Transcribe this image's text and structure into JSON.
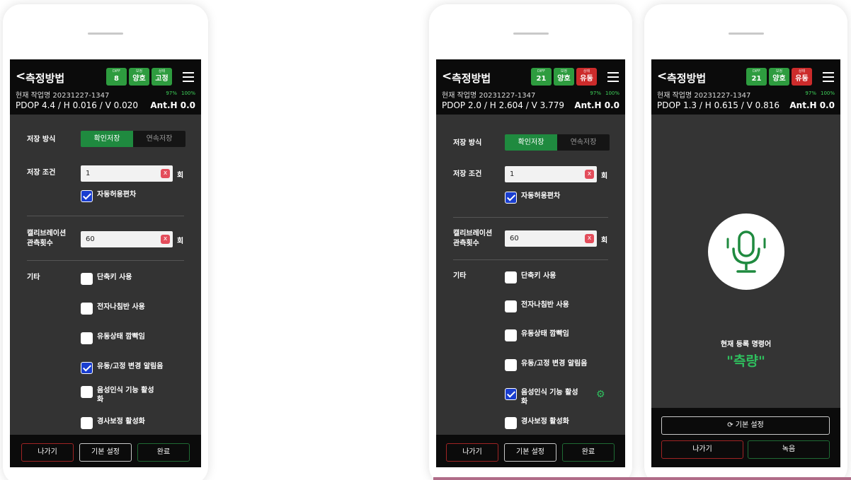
{
  "header": {
    "back_icon": "<",
    "title": "측정방법",
    "job_label": "현재 작업명 20231227-1347",
    "battery": "97%",
    "storage": "100%",
    "ant_h": "Ant.H 0.0"
  },
  "phone1": {
    "badges": [
      {
        "label": "DIFF",
        "value": "8",
        "color": "#2e9c3f"
      },
      {
        "label": "보정",
        "value": "양호",
        "color": "#2e9c3f"
      },
      {
        "label": "상태",
        "value": "고정",
        "color": "#2e9c3f"
      }
    ],
    "dop": "PDOP 4.4 / H 0.016 / V 0.020"
  },
  "phone2": {
    "badges": [
      {
        "label": "DIFF",
        "value": "21",
        "color": "#2e9c3f"
      },
      {
        "label": "보정",
        "value": "양호",
        "color": "#2e9c3f"
      },
      {
        "label": "상태",
        "value": "유동",
        "color": "#cc2b2b"
      }
    ],
    "dop": "PDOP 2.0 / H 2.604 / V 3.779"
  },
  "phone3": {
    "badges": [
      {
        "label": "DIFF",
        "value": "21",
        "color": "#2e9c3f"
      },
      {
        "label": "보정",
        "value": "양호",
        "color": "#2e9c3f"
      },
      {
        "label": "상태",
        "value": "유동",
        "color": "#cc2b2b"
      }
    ],
    "dop": "PDOP 1.3 / H 0.615 / V 0.816",
    "registered_label": "현재 등록 명령어",
    "registered_command": "\"측량\"",
    "reset_button": "기본 설정",
    "exit_button": "나가기",
    "record_button": "녹음",
    "mic_icon": "microphone-icon"
  },
  "form": {
    "save_method_label": "저장 방식",
    "save_confirm": "확인저장",
    "save_continuous": "연속저장",
    "save_condition_label": "저장 조건",
    "save_condition_value": "1",
    "unit": "회",
    "auto_tolerance": "자동허용편차",
    "calibration_label_1": "캘리브레이션",
    "calibration_label_2": "관측횟수",
    "calibration_value": "60",
    "etc_label": "기타",
    "opt_shortcut": "단축키 사용",
    "opt_compass": "전자나침반 사용",
    "opt_float_blink": "유동상태 깜빡임",
    "opt_float_fix_alarm": "유동/고정 변경 알림음",
    "opt_voice_1": "음성인식 기능 활성",
    "opt_voice_2": "화",
    "opt_tilt": "경사보정 활성화",
    "clear_icon": "x"
  },
  "footer": {
    "exit": "나가기",
    "reset": "기본 설정",
    "done": "완료"
  },
  "colors": {
    "accent_green": "#1f8a3f",
    "alert_red": "#cc2b2b",
    "checkbox_blue": "#1a3ecf"
  }
}
